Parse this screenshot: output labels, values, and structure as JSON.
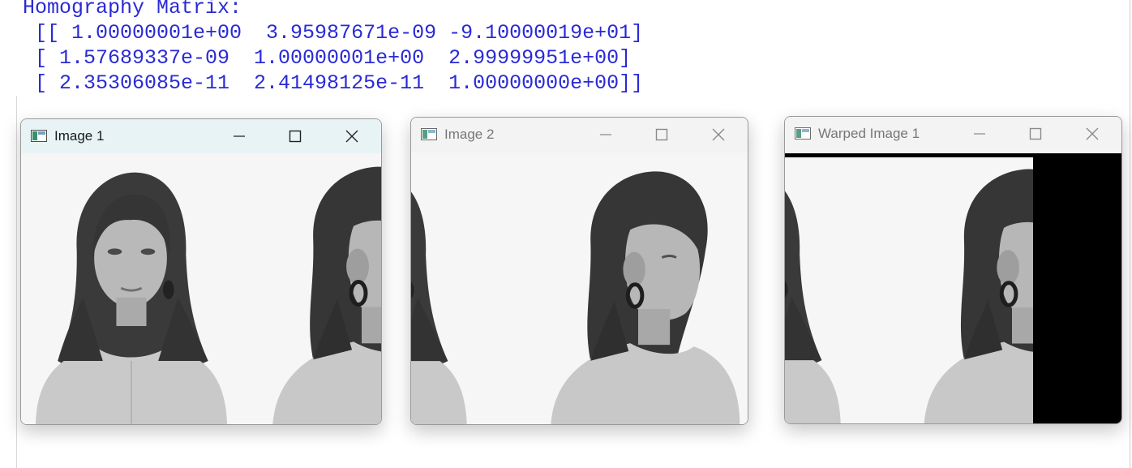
{
  "console": {
    "lines": [
      "Homography Matrix:",
      " [[ 1.00000001e+00  3.95987671e-09 -9.10000019e+01]",
      " [ 1.57689337e-09  1.00000001e+00  2.99999951e+00]",
      " [ 2.35306085e-11  2.41498125e-11  1.00000000e+00]]"
    ],
    "text_color": "#2a2ad6"
  },
  "windows": [
    {
      "title": "Image 1",
      "state": "active"
    },
    {
      "title": "Image 2",
      "state": "inactive"
    },
    {
      "title": "Warped Image 1",
      "state": "inactive"
    }
  ],
  "icons": {
    "app": "opencv-window-icon",
    "minimize": "minimize-icon",
    "maximize": "maximize-icon",
    "close": "close-icon"
  },
  "colors": {
    "title_active_bg": "#e8f3f6",
    "title_inactive_bg": "#f3f3f3",
    "warp_fill": "#000000"
  }
}
